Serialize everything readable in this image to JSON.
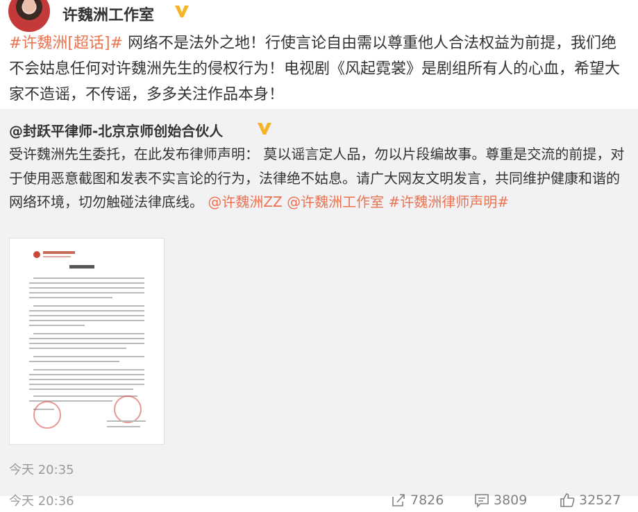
{
  "post": {
    "author": "许魏洲工作室",
    "topic": "#许魏洲[超话]#",
    "text": " 网络不是法外之地！行使言论自由需以尊重他人合法权益为前提，我们绝不会姑息任何对许魏洲先生的侵权行为！电视剧《风起霓裳》是剧组所有人的心血，希望大家不造谣，不传谣，多多关注作品本身！",
    "time": "今天 20:36"
  },
  "repost": {
    "author": "@封跃平律师-北京京师创始合伙人",
    "text": "受许魏洲先生委托，在此发布律师声明： 莫以谣言定人品，勿以片段编故事。尊重是交流的前提，对于使用恶意截图和发表不实言论的行为，法律绝不姑息。请广大网友文明发言，共同维护健康和谐的网络环境，切勿触碰法律底线。 ",
    "mention1": "@许魏洲ZZ",
    "mention2": "@许魏洲工作室",
    "topic": "#许魏洲律师声明#",
    "time": "今天 20:35"
  },
  "stats": {
    "shares": "7826",
    "comments": "3809",
    "likes": "32527"
  },
  "icons": {
    "verified": "verified-v-badge-icon",
    "share": "share-icon",
    "comment": "comment-icon",
    "like": "thumbs-up-icon"
  },
  "colors": {
    "accent": "#eb7350",
    "badge": "#f5b325",
    "repost_bg": "#f2f2f5",
    "muted": "#999999"
  }
}
